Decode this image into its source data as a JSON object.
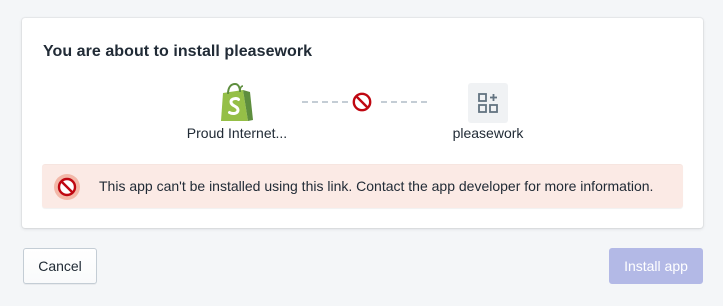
{
  "card": {
    "title": "You are about to install pleasework"
  },
  "connection": {
    "store_label": "Proud Internet...",
    "store_icon": "shopify-bag-icon",
    "link_status_icon": "blocked-icon",
    "app_label": "pleasework",
    "app_icon": "apps-grid-icon"
  },
  "banner": {
    "status": "critical",
    "icon": "blocked-icon",
    "message": "This app can't be installed using this link. Contact the app developer for more information."
  },
  "actions": {
    "cancel_label": "Cancel",
    "install_label": "Install app",
    "install_disabled": true
  },
  "colors": {
    "background": "#f4f6f8",
    "shopify_green": "#95bf47",
    "critical_red": "#bf0711",
    "banner_bg": "#fbeae5",
    "install_disabled_bg": "#b3b9e6"
  }
}
